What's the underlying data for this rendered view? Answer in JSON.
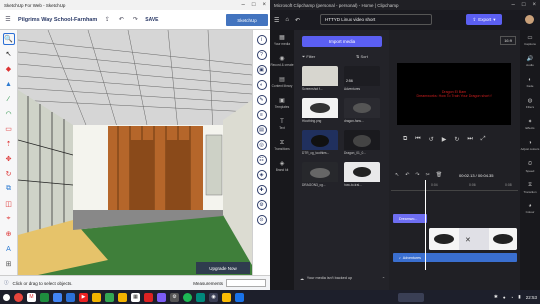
{
  "sketchup": {
    "window_title": "SketchUp For Web - SketchUp",
    "doc_title": "Pilgrims Way School-Farnham",
    "save_label": "SAVE",
    "brand": "SketchUp",
    "status_text": "Click or drag to select objects.",
    "measurements_label": "Measurements",
    "upgrade_label": "Upgrade Now"
  },
  "clipchamp": {
    "window_title": "Microsoft Clipchamp (personal - personal) - Home | Clipchamp",
    "project_name": "HTTYD Linux video short",
    "export_label": "Export",
    "import_label": "Import media",
    "filter_label": "Filter",
    "sort_label": "Sort",
    "aspect_ratio": "16:9",
    "preview_line1": "Dragon El Bam",
    "preview_line2": "Dreamworks: How To Train Your Dragon short f",
    "timecode": "00:02.13 / 00:04.35",
    "ruler_ticks": [
      "0:04",
      "0:06",
      "0:08"
    ],
    "track_text": "Dreamwo...",
    "track_audio": "Adventures",
    "backup_text": "Your media isn't backed up",
    "nav": [
      "Your media",
      "Record & create",
      "Content library",
      "Templates",
      "Text",
      "Transitions",
      "Brand kit"
    ],
    "props": [
      "Captions",
      "Audio",
      "Fade",
      "Filters",
      "Effects",
      "Adjust colours",
      "Speed",
      "Transition",
      "Colour"
    ],
    "media": [
      {
        "label": "Screenshot f...",
        "color": "#d7d6cf"
      },
      {
        "label": "Adventures",
        "color": "#1d1d22"
      },
      {
        "label": "Hiccthing.png",
        "color": "#f3f3f3"
      },
      {
        "label": "dragon-fans...",
        "color": "#2a2a30"
      },
      {
        "label": "DTR_cg_toothles...",
        "color": "#20305e"
      },
      {
        "label": "Dragon_01_0...",
        "color": "#1a1a1e"
      },
      {
        "label": "DRAGON3_cg...",
        "color": "#27282c"
      },
      {
        "label": "how-to-trai...",
        "color": "#e9e9ea"
      }
    ]
  },
  "taskbar": {
    "time": "22:53"
  }
}
